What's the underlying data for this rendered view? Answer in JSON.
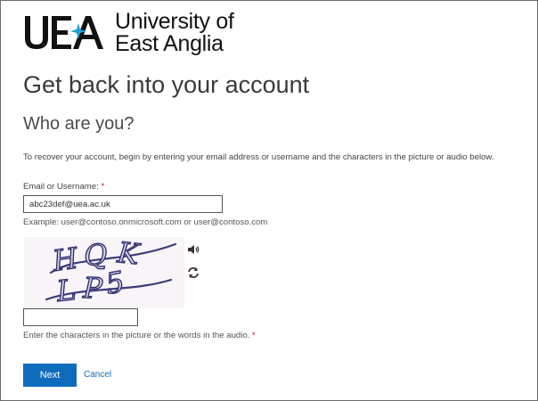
{
  "brand": {
    "logo_letters": "UEA",
    "name_line1": "University of",
    "name_line2": "East Anglia",
    "accent_color": "#1e9fd8"
  },
  "page": {
    "title": "Get back into your account",
    "subtitle": "Who are you?",
    "instructions": "To recover your account, begin by entering your email address or username and the characters in the picture or audio below."
  },
  "email": {
    "label": "Email or Username:",
    "required_mark": "*",
    "value": "abc23def@uea.ac.uk",
    "example": "Example: user@contoso.onmicrosoft.com or user@contoso.com"
  },
  "captcha": {
    "image_text": "HQK LP5",
    "audio_icon": "speaker-icon",
    "refresh_icon": "refresh-icon",
    "input_value": "",
    "help": "Enter the characters in the picture or the words in the audio.",
    "required_mark": "*"
  },
  "actions": {
    "next_label": "Next",
    "cancel_label": "Cancel",
    "primary_color": "#0f6cbd"
  }
}
